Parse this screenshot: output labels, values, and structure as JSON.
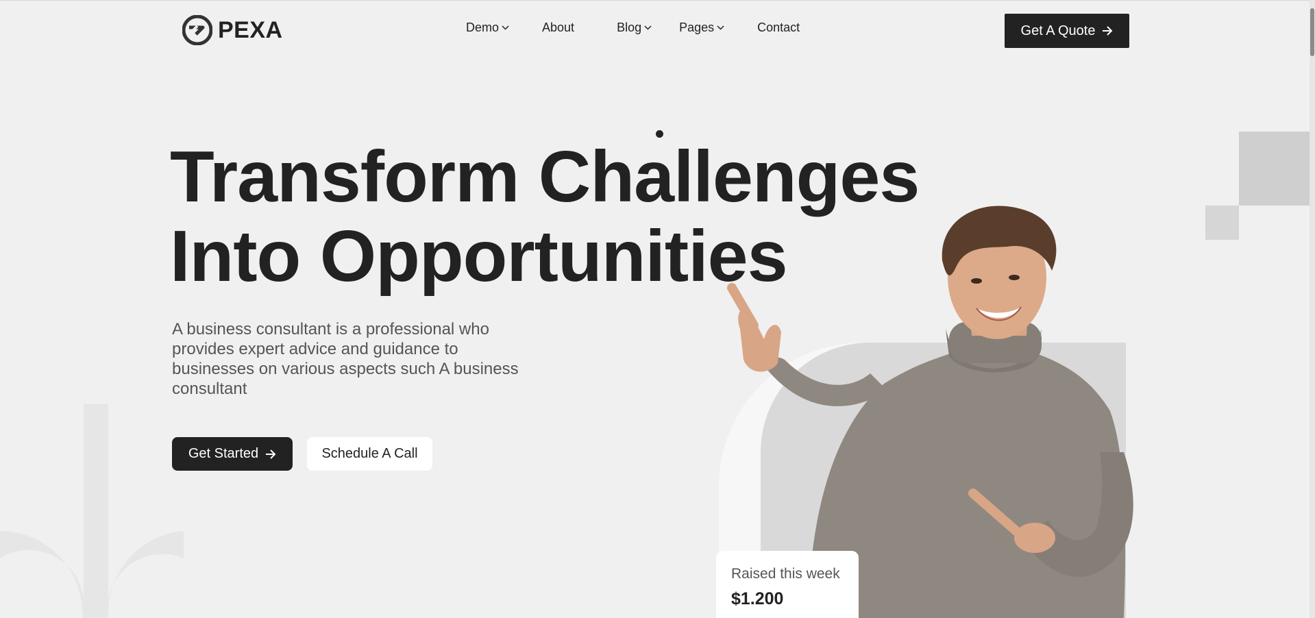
{
  "header": {
    "logo_text": "PEXA",
    "nav": [
      {
        "label": "Demo",
        "has_dropdown": true
      },
      {
        "label": "About",
        "has_dropdown": false
      },
      {
        "label": "Blog",
        "has_dropdown": true
      },
      {
        "label": "Pages",
        "has_dropdown": true
      },
      {
        "label": "Contact",
        "has_dropdown": false
      }
    ],
    "quote_button": "Get A Quote"
  },
  "hero": {
    "title_line1": "Transform Challenges",
    "title_line2": "Into Opportunities",
    "description": "A business consultant is a professional who provides expert advice and guidance to businesses on various aspects such A business consultant",
    "primary_button": "Get Started",
    "secondary_button": "Schedule A Call"
  },
  "stat_card": {
    "label": "Raised this week",
    "value": "$1.200"
  },
  "icons": {
    "logo": "logo-icon",
    "chevron": "chevron-down-icon",
    "arrow": "arrow-right-icon"
  },
  "colors": {
    "background": "#f0f0f0",
    "primary": "#222222",
    "panel": "#d9d9d9",
    "card": "#ffffff"
  }
}
